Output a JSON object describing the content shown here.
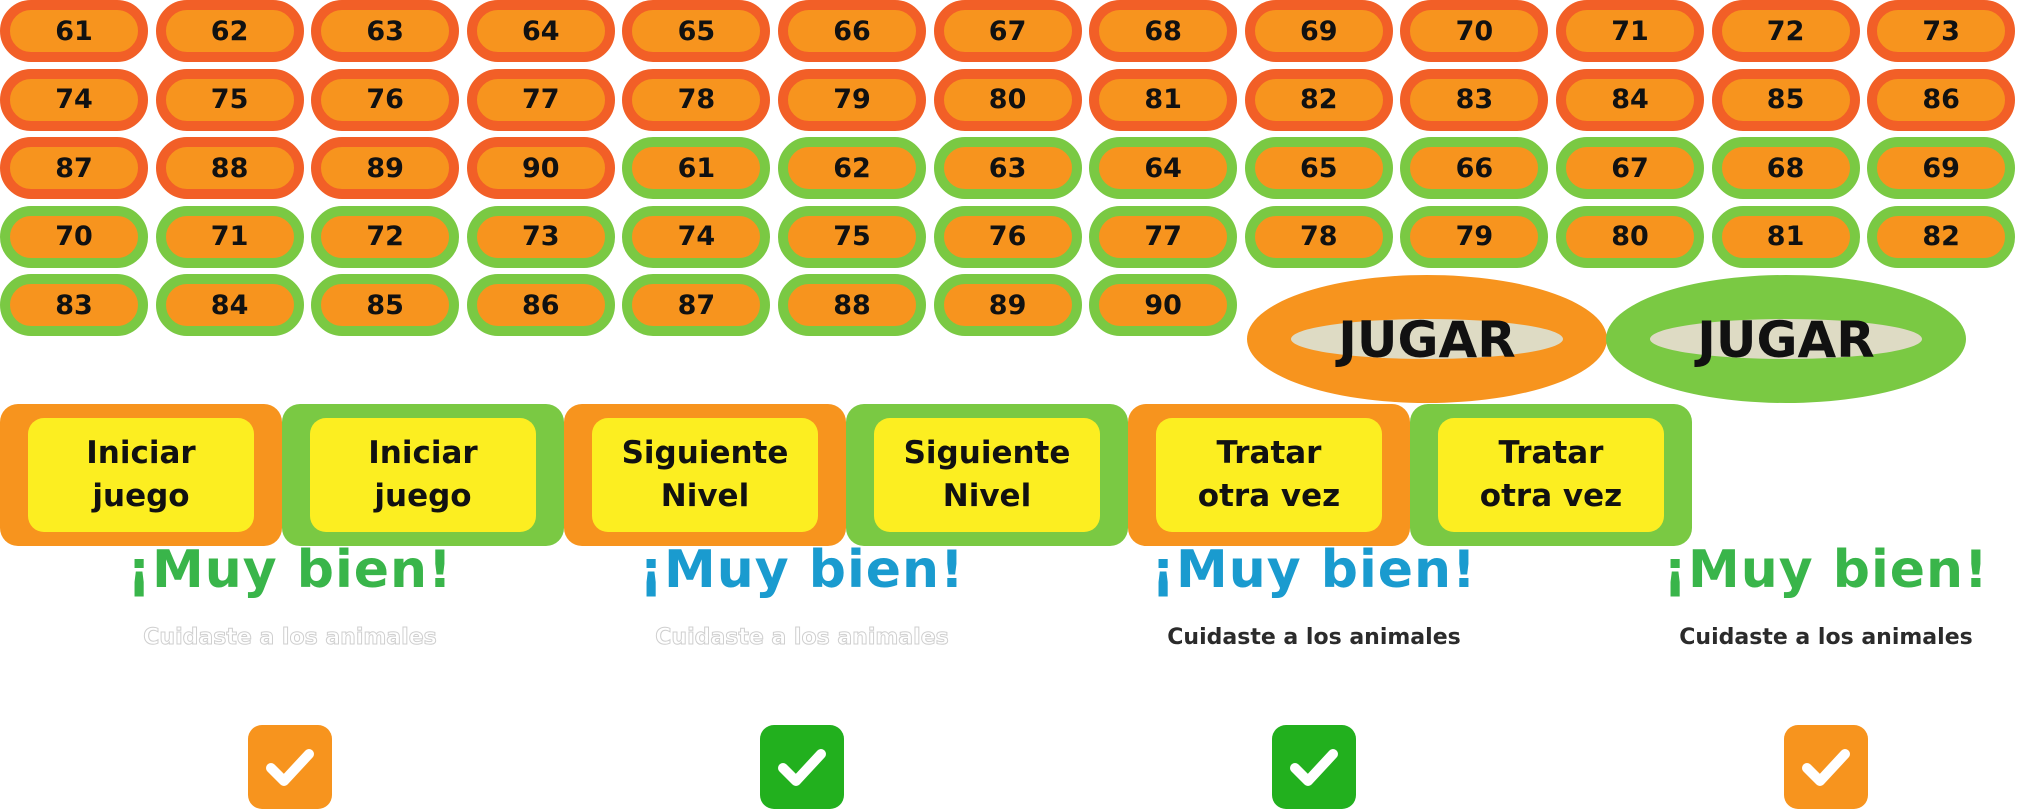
{
  "colors": {
    "orange": "#f7941e",
    "red_orange": "#f25f27",
    "green": "#7ac943",
    "dark_green": "#22b01e",
    "yellow": "#fcee21",
    "beige": "#dedbc4",
    "blue": "#1a9bcf"
  },
  "number_buttons": [
    {
      "label": "61",
      "variant": "red"
    },
    {
      "label": "62",
      "variant": "red"
    },
    {
      "label": "63",
      "variant": "red"
    },
    {
      "label": "64",
      "variant": "red"
    },
    {
      "label": "65",
      "variant": "red"
    },
    {
      "label": "66",
      "variant": "red"
    },
    {
      "label": "67",
      "variant": "red"
    },
    {
      "label": "68",
      "variant": "red"
    },
    {
      "label": "69",
      "variant": "red"
    },
    {
      "label": "70",
      "variant": "red"
    },
    {
      "label": "71",
      "variant": "red"
    },
    {
      "label": "72",
      "variant": "red"
    },
    {
      "label": "73",
      "variant": "red"
    },
    {
      "label": "74",
      "variant": "red"
    },
    {
      "label": "75",
      "variant": "red"
    },
    {
      "label": "76",
      "variant": "red"
    },
    {
      "label": "77",
      "variant": "red"
    },
    {
      "label": "78",
      "variant": "red"
    },
    {
      "label": "79",
      "variant": "red"
    },
    {
      "label": "80",
      "variant": "red"
    },
    {
      "label": "81",
      "variant": "red"
    },
    {
      "label": "82",
      "variant": "red"
    },
    {
      "label": "83",
      "variant": "red"
    },
    {
      "label": "84",
      "variant": "red"
    },
    {
      "label": "85",
      "variant": "red"
    },
    {
      "label": "86",
      "variant": "red"
    },
    {
      "label": "87",
      "variant": "red"
    },
    {
      "label": "88",
      "variant": "red"
    },
    {
      "label": "89",
      "variant": "red"
    },
    {
      "label": "90",
      "variant": "red"
    },
    {
      "label": "61",
      "variant": "green"
    },
    {
      "label": "62",
      "variant": "green"
    },
    {
      "label": "63",
      "variant": "green"
    },
    {
      "label": "64",
      "variant": "green"
    },
    {
      "label": "65",
      "variant": "green"
    },
    {
      "label": "66",
      "variant": "green"
    },
    {
      "label": "67",
      "variant": "green"
    },
    {
      "label": "68",
      "variant": "green"
    },
    {
      "label": "69",
      "variant": "green"
    },
    {
      "label": "70",
      "variant": "green"
    },
    {
      "label": "71",
      "variant": "green"
    },
    {
      "label": "72",
      "variant": "green"
    },
    {
      "label": "73",
      "variant": "green"
    },
    {
      "label": "74",
      "variant": "green"
    },
    {
      "label": "75",
      "variant": "green"
    },
    {
      "label": "76",
      "variant": "green"
    },
    {
      "label": "77",
      "variant": "green"
    },
    {
      "label": "78",
      "variant": "green"
    },
    {
      "label": "79",
      "variant": "green"
    },
    {
      "label": "80",
      "variant": "green"
    },
    {
      "label": "81",
      "variant": "green"
    },
    {
      "label": "82",
      "variant": "green"
    },
    {
      "label": "83",
      "variant": "green"
    },
    {
      "label": "84",
      "variant": "green"
    },
    {
      "label": "85",
      "variant": "green"
    },
    {
      "label": "86",
      "variant": "green"
    },
    {
      "label": "87",
      "variant": "green"
    },
    {
      "label": "88",
      "variant": "green"
    },
    {
      "label": "89",
      "variant": "green"
    },
    {
      "label": "90",
      "variant": "green"
    }
  ],
  "play_buttons": [
    {
      "label": "JUGAR",
      "variant": "orange"
    },
    {
      "label": "JUGAR",
      "variant": "green"
    }
  ],
  "action_buttons": [
    {
      "label": "Iniciar\njuego",
      "variant": "orange"
    },
    {
      "label": "Iniciar\njuego",
      "variant": "green"
    },
    {
      "label": "Siguiente\nNivel",
      "variant": "orange"
    },
    {
      "label": "Siguiente\nNivel",
      "variant": "green"
    },
    {
      "label": "Tratar\notra vez",
      "variant": "orange"
    },
    {
      "label": "Tratar\notra vez",
      "variant": "green"
    }
  ],
  "feedback_panels": [
    {
      "title": "¡Muy bien!",
      "title_color": "green",
      "subtitle": "Cuidaste a los animales",
      "subtitle_style": "light",
      "check_color": "orange",
      "check_icon": "checkmark-icon"
    },
    {
      "title": "¡Muy bien!",
      "title_color": "blue",
      "subtitle": "Cuidaste a los animales",
      "subtitle_style": "light",
      "check_color": "green",
      "check_icon": "checkmark-icon"
    },
    {
      "title": "¡Muy bien!",
      "title_color": "blue",
      "subtitle": "Cuidaste a los animales",
      "subtitle_style": "dark",
      "check_color": "green",
      "check_icon": "checkmark-icon"
    },
    {
      "title": "¡Muy bien!",
      "title_color": "green",
      "subtitle": "Cuidaste a los animales",
      "subtitle_style": "dark",
      "check_color": "orange",
      "check_icon": "checkmark-icon"
    }
  ]
}
